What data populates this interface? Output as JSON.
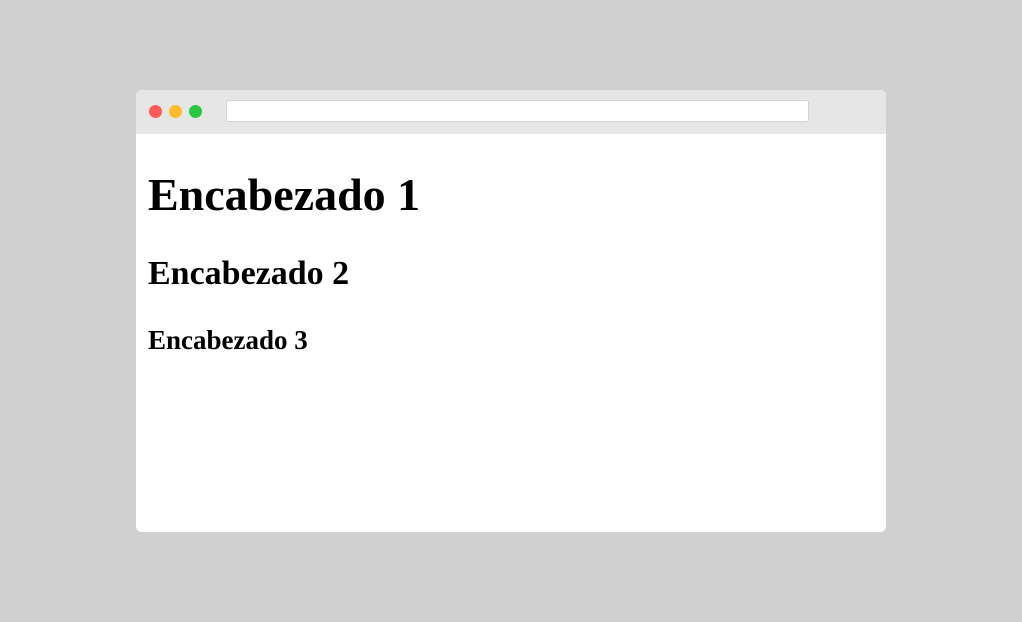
{
  "browser": {
    "address_value": "",
    "window_buttons": {
      "close_color": "#fc5b57",
      "minimize_color": "#fdbb2e",
      "maximize_color": "#27c840"
    }
  },
  "page": {
    "heading_1": "Encabezado 1",
    "heading_2": "Encabezado 2",
    "heading_3": "Encabezado 3"
  }
}
